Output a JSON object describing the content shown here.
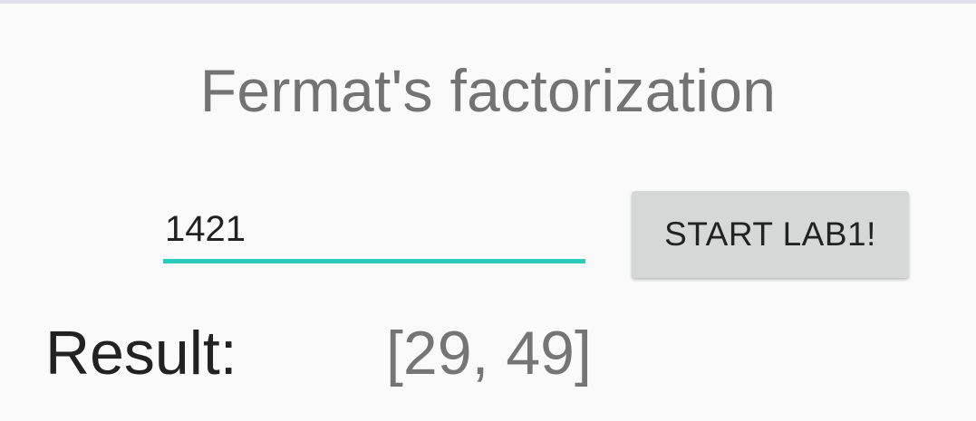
{
  "app": {
    "title": "Fermat's factorization"
  },
  "form": {
    "number_value": "1421",
    "start_button_label": "START LAB1!"
  },
  "result": {
    "label": "Result:",
    "value": "[29, 49]"
  },
  "colors": {
    "accent_underline": "#2bcbba",
    "button_background": "#d6d7d7",
    "background": "#fafafa"
  }
}
